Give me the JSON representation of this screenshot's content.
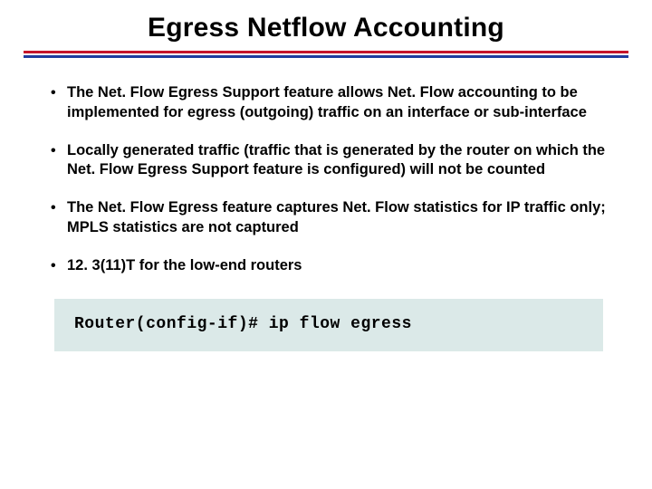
{
  "title": "Egress Netflow Accounting",
  "bullets": [
    "The Net. Flow Egress Support feature allows Net. Flow accounting to be implemented for egress (outgoing) traffic on an interface or sub-interface",
    "Locally generated traffic (traffic that is generated by the router on which the Net. Flow Egress Support feature is configured) will not be counted",
    "The Net. Flow Egress feature captures Net. Flow statistics for IP traffic only; MPLS statistics are not captured",
    "12. 3(11)T for the low-end routers"
  ],
  "code": "Router(config-if)# ip flow egress",
  "colors": {
    "rule_red": "#c6142b",
    "rule_blue": "#1f3c9f",
    "code_bg": "#dbe9e8"
  }
}
